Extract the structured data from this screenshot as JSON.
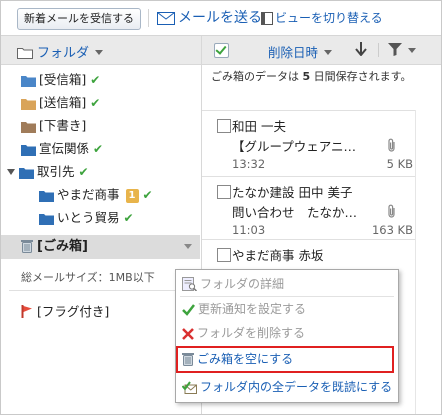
{
  "toolbar": {
    "receive_label": "新着メールを受信する",
    "send_label": "メールを送る",
    "view_label": "ビューを切り替える"
  },
  "folder_pane": {
    "header": "フォルダ",
    "folders": [
      {
        "label": "[受信箱]",
        "icon": "folder-open-icon",
        "color": "#4a86c8",
        "checked": true
      },
      {
        "label": "[送信箱]",
        "icon": "folder-icon",
        "color": "#d9a45a",
        "checked": true
      },
      {
        "label": "[下書き]",
        "icon": "folder-icon",
        "color": "#a07c5a",
        "checked": false
      },
      {
        "label": "宣伝関係",
        "icon": "folder-icon",
        "color": "#2f6fb5",
        "checked": true
      },
      {
        "label": "取引先",
        "icon": "folder-icon",
        "color": "#2f6fb5",
        "checked": true
      },
      {
        "label": "やまだ商事",
        "icon": "folder-icon",
        "color": "#2f6fb5",
        "badge": "1",
        "checked": true
      },
      {
        "label": "いとう貿易",
        "icon": "folder-icon",
        "color": "#2f6fb5",
        "checked": true
      }
    ],
    "trash": {
      "label": "[ごみ箱]",
      "icon": "trash-icon"
    },
    "total_size": "総メールサイズ：1MB以下",
    "flagged": {
      "label": "[フラグ付き]",
      "icon": "flag-icon"
    }
  },
  "mail_list": {
    "sort_label": "削除日時",
    "notice_pre": "ごみ箱のデータは ",
    "notice_days": "5",
    "notice_post": " 日間保存されます。",
    "mails": [
      {
        "sender": "和田 一夫",
        "subject": "【グループウェアニ…",
        "time": "13:32",
        "size": "5 KB",
        "attachment": true
      },
      {
        "sender": "たなか建設 田中 美子",
        "subject": "問い合わせ　たなか…",
        "time": "11:03",
        "size": "163 KB",
        "attachment": true
      },
      {
        "sender": "やまだ商事 赤坂",
        "subject": "",
        "time": "",
        "size": "",
        "attachment": false
      }
    ]
  },
  "context_menu": {
    "items": [
      {
        "label": "フォルダの詳細",
        "icon": "folder-detail-icon",
        "enabled": false
      },
      {
        "label": "更新通知を設定する",
        "icon": "check-icon",
        "enabled": false
      },
      {
        "label": "フォルダを削除する",
        "icon": "delete-x-icon",
        "enabled": false
      },
      {
        "label": "ごみ箱を空にする",
        "icon": "trash-icon",
        "enabled": true,
        "highlighted": true
      },
      {
        "label": "フォルダ内の全データを既読にする",
        "icon": "mark-read-icon",
        "enabled": true
      }
    ]
  },
  "colors": {
    "link": "#1a5fb4",
    "check": "#3da33d",
    "badge": "#e8b44b",
    "highlight_border": "#e02020",
    "delete_red": "#d93030"
  }
}
